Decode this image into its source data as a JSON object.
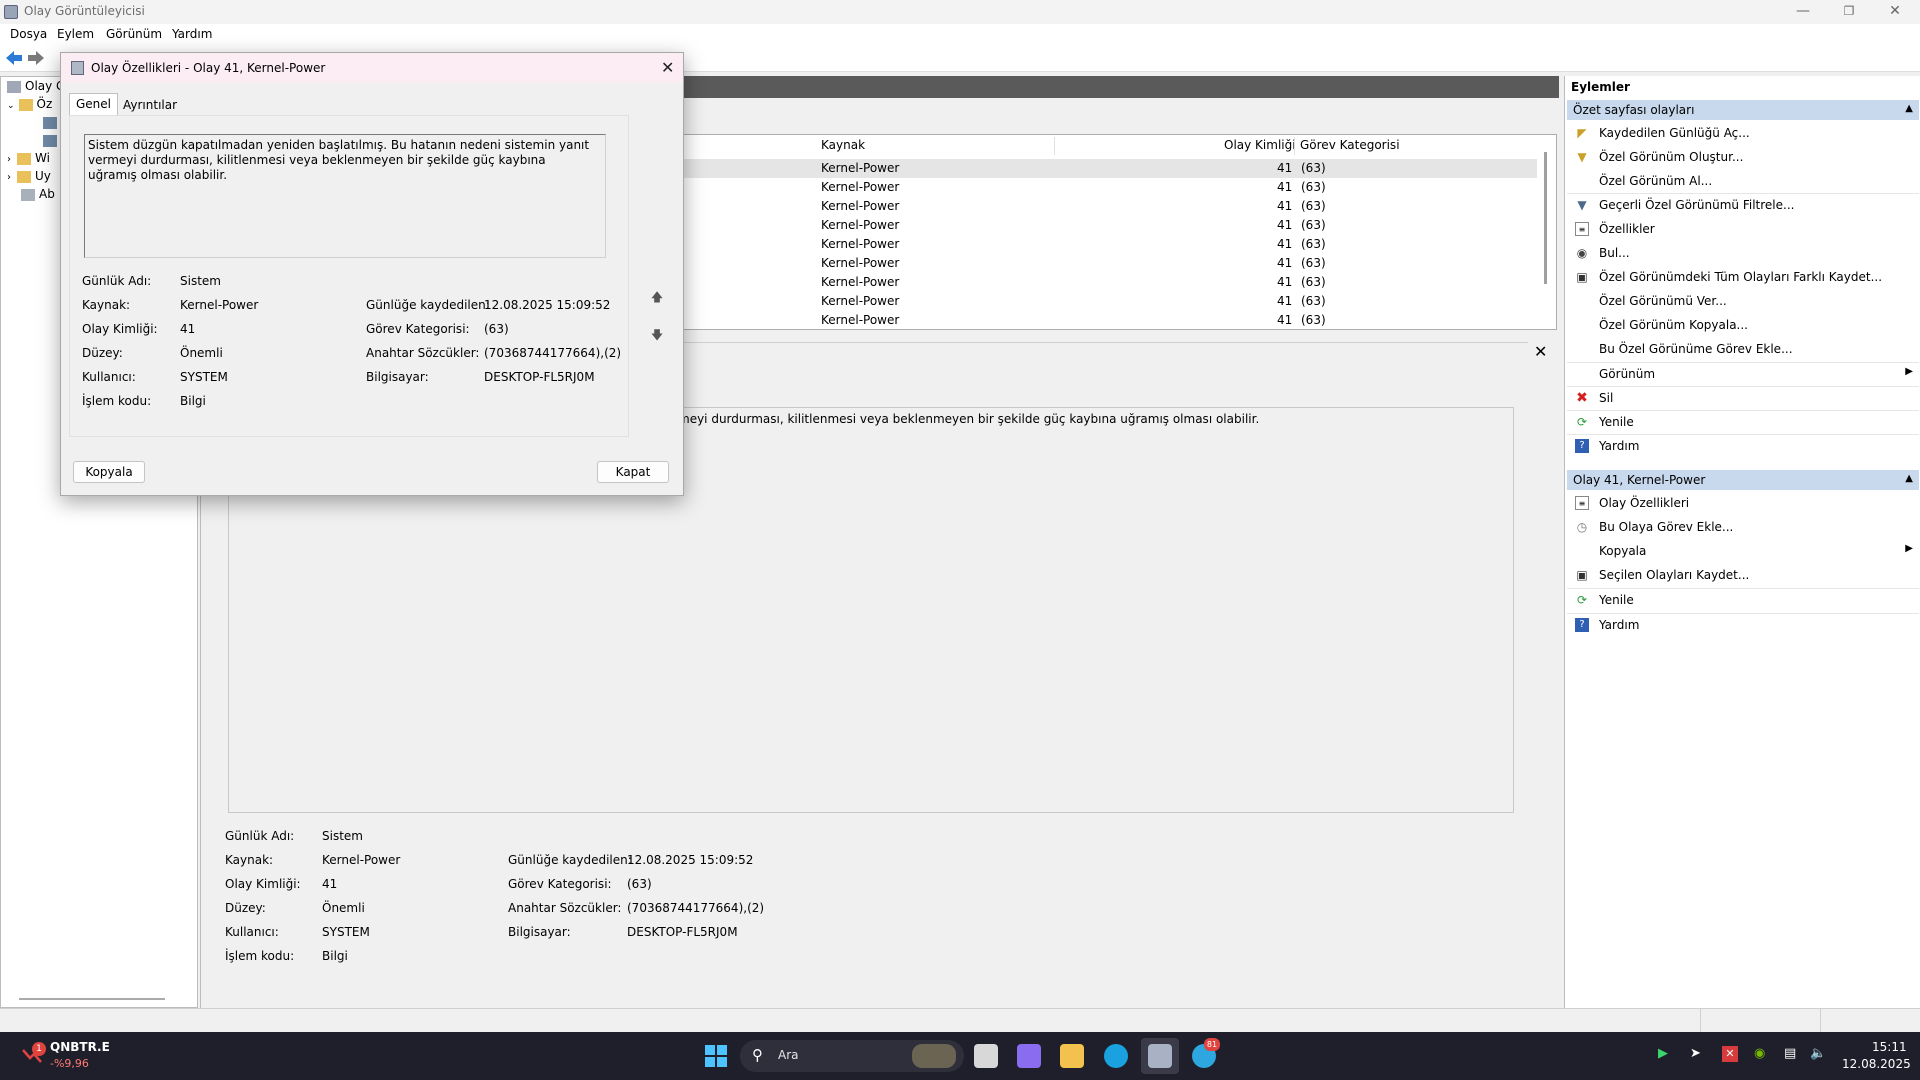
{
  "window": {
    "title": "Olay Görüntüleyicisi"
  },
  "menu": [
    "Dosya",
    "Eylem",
    "Görünüm",
    "Yardım"
  ],
  "tree": [
    "Olay G",
    "Öz",
    "Wi",
    "Uy",
    "Ab"
  ],
  "grid": {
    "columns": {
      "source": "Kaynak",
      "event_id": "Olay Kimliği",
      "task": "Görev Kategorisi"
    },
    "rows": [
      {
        "source": "Kernel-Power",
        "event_id": "41",
        "task": "(63)"
      },
      {
        "source": "Kernel-Power",
        "event_id": "41",
        "task": "(63)"
      },
      {
        "source": "Kernel-Power",
        "event_id": "41",
        "task": "(63)"
      },
      {
        "source": "Kernel-Power",
        "event_id": "41",
        "task": "(63)"
      },
      {
        "source": "Kernel-Power",
        "event_id": "41",
        "task": "(63)"
      },
      {
        "source": "Kernel-Power",
        "event_id": "41",
        "task": "(63)"
      },
      {
        "source": "Kernel-Power",
        "event_id": "41",
        "task": "(63)"
      },
      {
        "source": "Kernel-Power",
        "event_id": "41",
        "task": "(63)"
      },
      {
        "source": "Kernel-Power",
        "event_id": "41",
        "task": "(63)"
      }
    ]
  },
  "detail": {
    "description_fragment": "meyi durdurması, kilitlenmesi veya beklenmeyen bir şekilde güç kaybına uğramış olması olabilir.",
    "fields": {
      "log_name_label": "Günlük Adı:",
      "log_name": "Sistem",
      "source_label": "Kaynak:",
      "source": "Kernel-Power",
      "event_id_label": "Olay Kimliği:",
      "event_id": "41",
      "level_label": "Düzey:",
      "level": "Önemli",
      "user_label": "Kullanıcı:",
      "user": "SYSTEM",
      "opcode_label": "İşlem kodu:",
      "opcode": "Bilgi",
      "logged_label": "Günlüğe kaydedilen:",
      "logged": "12.08.2025 15:09:52",
      "task_label": "Görev Kategorisi:",
      "task": "(63)",
      "keywords_label": "Anahtar Sözcükler:",
      "keywords": "(70368744177664),(2)",
      "computer_label": "Bilgisayar:",
      "computer": "DESKTOP-FL5RJ0M"
    }
  },
  "dialog": {
    "title": "Olay Özellikleri - Olay 41, Kernel-Power",
    "tabs": [
      "Genel",
      "Ayrıntılar"
    ],
    "description": "Sistem düzgün kapatılmadan yeniden başlatılmış. Bu hatanın nedeni sistemin yanıt vermeyi durdurması, kilitlenmesi veya beklenmeyen bir şekilde güç kaybına uğramış olması olabilir.",
    "copy_button": "Kopyala",
    "close_button": "Kapat"
  },
  "actions": {
    "title": "Eylemler",
    "section1": "Özet sayfası olayları",
    "items1": [
      "Kaydedilen Günlüğü Aç...",
      "Özel Görünüm Oluştur...",
      "Özel Görünüm Al...",
      "Geçerli Özel Görünümü Filtrele...",
      "Özellikler",
      "Bul...",
      "Özel Görünümdeki Tüm Olayları Farklı Kaydet...",
      "Özel Görünümü Ver...",
      "Özel Görünüm Kopyala...",
      "Bu Özel Görünüme Görev Ekle...",
      "Görünüm",
      "Sil",
      "Yenile",
      "Yardım"
    ],
    "section2": "Olay 41, Kernel-Power",
    "items2": [
      "Olay Özellikleri",
      "Bu Olaya Görev Ekle...",
      "Kopyala",
      "Seçilen Olayları Kaydet...",
      "Yenile",
      "Yardım"
    ]
  },
  "taskbar": {
    "stock_name": "QNBTR.E",
    "stock_change": "-%9,96",
    "stock_badge": "1",
    "search": "Ara",
    "telegram_badge": "81",
    "time": "15:11",
    "date": "12.08.2025"
  },
  "colors": {
    "section_bg": "#c8d9ee",
    "taskbar_bg": "#1f1f2b",
    "dialog_title_bg": "#fcecf3"
  }
}
